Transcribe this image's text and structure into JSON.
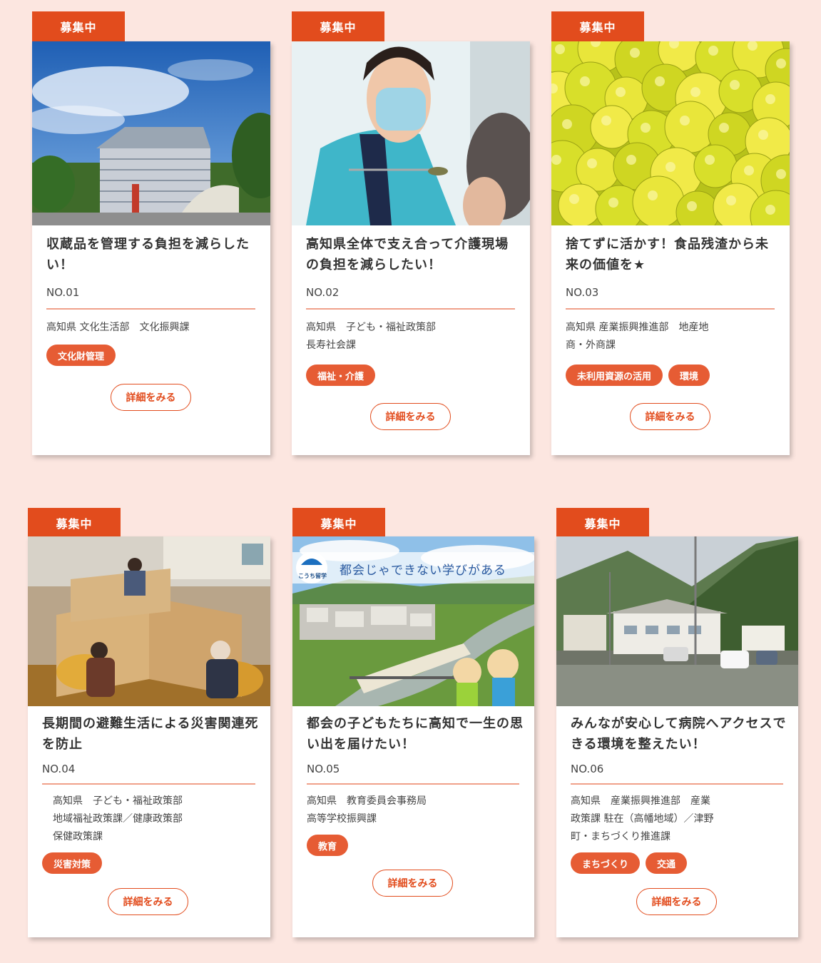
{
  "cards": [
    {
      "badge": "募集中",
      "photo_icon": "museum-building-photo",
      "title": "収蔵品を管理する負担を減らしたい！",
      "number": "NO.01",
      "department": "高知県 文化生活部　文化振興課",
      "tags": [
        "文化財管理"
      ],
      "more_label": "詳細をみる"
    },
    {
      "badge": "募集中",
      "photo_icon": "caregiver-feeding-photo",
      "title": "高知県全体で支え合って介護現場の負担を減らしたい！",
      "number": "NO.02",
      "department": "高知県　子ども・福祉政策部\n長寿社会課",
      "tags": [
        "福祉・介護"
      ],
      "more_label": "詳細をみる"
    },
    {
      "badge": "募集中",
      "photo_icon": "yuzu-fruit-photo",
      "title": "捨てずに活かす！食品残渣から未来の価値を★",
      "number": "NO.03",
      "department": "高知県 産業振興推進部　地産地\n商・外商課",
      "tags": [
        "未利用資源の活用",
        "環境"
      ],
      "more_label": "詳細をみる"
    },
    {
      "badge": "募集中",
      "photo_icon": "evacuation-shelter-photo",
      "title": "長期間の避難生活による災害関連死を防止",
      "number": "NO.04",
      "department": "高知県　子ども・福祉政策部\n地域福祉政策課／健康政策部\n保健政策課",
      "tags": [
        "災害対策"
      ],
      "more_label": "詳細をみる"
    },
    {
      "badge": "募集中",
      "photo_icon": "river-landscape-photo",
      "photo_logo": "こうち留学",
      "photo_caption": "都会じゃできない学びがある",
      "title": "都会の子どもたちに高知で一生の思い出を届けたい！",
      "number": "NO.05",
      "department": "高知県　教育委員会事務局\n高等学校振興課",
      "tags": [
        "教育"
      ],
      "more_label": "詳細をみる"
    },
    {
      "badge": "募集中",
      "photo_icon": "hospital-street-photo",
      "title": "みんなが安心して病院へアクセスできる環境を整えたい！",
      "number": "NO.06",
      "department": "高知県　産業振興推進部　産業\n政策課 駐在（高幡地域）／津野\n町・まちづくり推進課",
      "tags": [
        "まちづくり",
        "交通"
      ],
      "more_label": "詳細をみる"
    }
  ],
  "colors": {
    "background": "#fce6e0",
    "accent": "#e24c1d",
    "tag": "#e65c34",
    "rule": "#f0a08a"
  }
}
